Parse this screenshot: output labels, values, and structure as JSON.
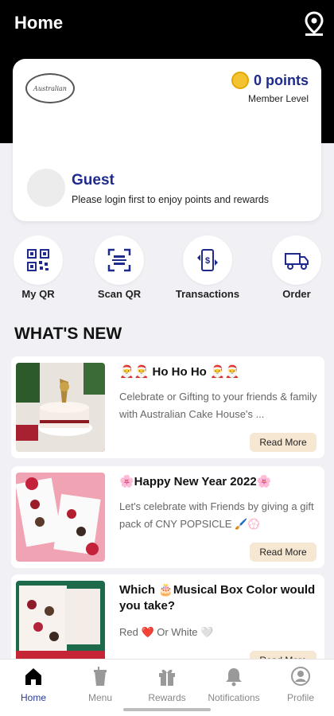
{
  "header": {
    "title": "Home",
    "location_icon": "location-pin-icon"
  },
  "member_card": {
    "logo_text": "Australian",
    "points": "0 points",
    "member_level": "Member Level",
    "name": "Guest",
    "subtitle": "Please login first to enjoy points and rewards"
  },
  "actions": [
    {
      "label": "My QR",
      "icon": "qr-code-icon"
    },
    {
      "label": "Scan QR",
      "icon": "scan-qr-icon"
    },
    {
      "label": "Transactions",
      "icon": "transactions-icon"
    },
    {
      "label": "Order",
      "icon": "delivery-truck-icon"
    }
  ],
  "whats_new": {
    "title": "WHAT'S NEW",
    "items": [
      {
        "title": "🎅🎅 Ho Ho Ho 🎅🎅",
        "description": "Celebrate or Gifting to your friends & family with Australian Cake House's ...",
        "button": "Read More"
      },
      {
        "title": "🌸Happy New Year 2022🌸",
        "description": "Let's celebrate with Friends by giving a gift pack of CNY POPSICLE 🖌️💮",
        "button": "Read More"
      },
      {
        "title": "Which 🎂Musical Box Color would you take?",
        "description": "Red ❤️ Or White 🤍",
        "button": "Read More"
      }
    ]
  },
  "nav": [
    {
      "label": "Home",
      "icon": "home-icon"
    },
    {
      "label": "Menu",
      "icon": "menu-cup-icon"
    },
    {
      "label": "Rewards",
      "icon": "gift-icon"
    },
    {
      "label": "Notifications",
      "icon": "bell-icon"
    },
    {
      "label": "Profile",
      "icon": "profile-icon"
    }
  ],
  "colors": {
    "brand_navy": "#1e2a8c",
    "coin": "#f4c430",
    "readmore_bg": "#f6e7d3"
  }
}
